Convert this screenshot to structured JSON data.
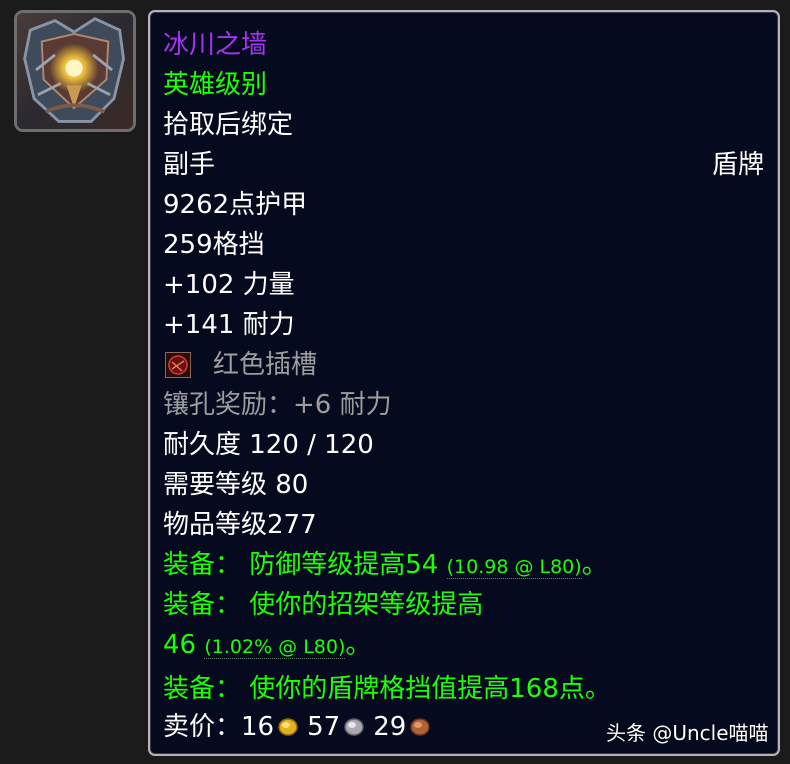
{
  "item": {
    "name": "冰川之墙",
    "quality": "英雄级别",
    "bind": "拾取后绑定",
    "slot": "副手",
    "type": "盾牌",
    "armor": "9262点护甲",
    "block": "259格挡",
    "stat_strength": "+102 力量",
    "stat_stamina": "+141 耐力",
    "socket_label": "红色插槽",
    "socket_bonus": "镶孔奖励：+6 耐力",
    "durability": "耐久度 120 / 120",
    "required_level": "需要等级 80",
    "item_level": "物品等级277",
    "equip_1_main": "装备：  防御等级提高54 ",
    "equip_1_detail": "(10.98 @ L80)",
    "equip_1_end": "。",
    "equip_2_main": "装备：  使你的招架等级提高",
    "equip_2b_main": "46 ",
    "equip_2b_detail": "(1.02% @ L80)",
    "equip_2b_end": "。",
    "equip_3": "装备：  使你的盾牌格挡值提高168点。",
    "sell_label": "卖价：",
    "sell_gold": "16",
    "sell_silver": "57",
    "sell_copper": "29"
  },
  "icons": {
    "item_icon": "shield-item-icon",
    "socket": "red-socket-icon",
    "gold": "gold-coin-icon",
    "silver": "silver-coin-icon",
    "copper": "copper-coin-icon"
  },
  "colors": {
    "epic": "#a335ee",
    "green": "#1eff00",
    "white": "#ffffff",
    "gray": "#9d9d9d",
    "background": "#060a1e"
  },
  "watermark": "头条 @Uncle喵喵"
}
